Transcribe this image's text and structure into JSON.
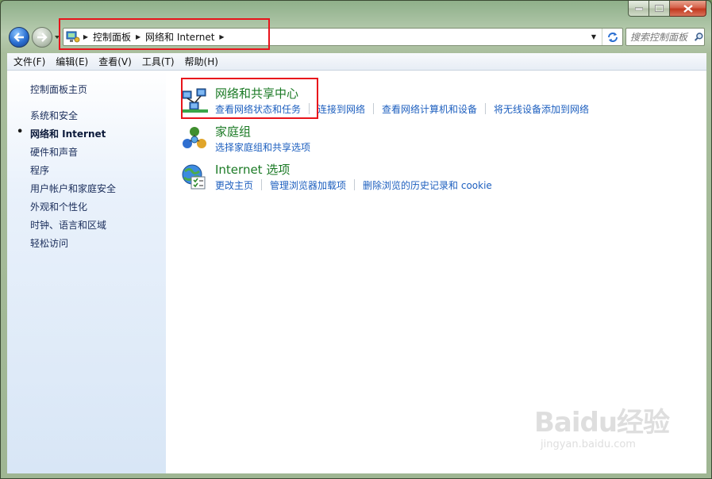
{
  "window": {
    "caption": {
      "minimize": "minimize",
      "maximize": "maximize",
      "close": "close"
    }
  },
  "address_bar": {
    "crumbs": [
      "控制面板",
      "网络和 Internet"
    ]
  },
  "search": {
    "placeholder": "搜索控制面板"
  },
  "menu": [
    "文件(F)",
    "编辑(E)",
    "查看(V)",
    "工具(T)",
    "帮助(H)"
  ],
  "sidebar": {
    "home": "控制面板主页",
    "items": [
      "系统和安全",
      "网络和 Internet",
      "硬件和声音",
      "程序",
      "用户帐户和家庭安全",
      "外观和个性化",
      "时钟、语言和区域",
      "轻松访问"
    ],
    "active_index": 1
  },
  "categories": [
    {
      "title": "网络和共享中心",
      "icon": "network-sharing-center-icon",
      "links": [
        "查看网络状态和任务",
        "连接到网络",
        "查看网络计算机和设备",
        "将无线设备添加到网络"
      ]
    },
    {
      "title": "家庭组",
      "icon": "homegroup-icon",
      "links": [
        "选择家庭组和共享选项"
      ]
    },
    {
      "title": "Internet 选项",
      "icon": "internet-options-icon",
      "links": [
        "更改主页",
        "管理浏览器加载项",
        "删除浏览的历史记录和 cookie"
      ]
    }
  ],
  "watermark": {
    "brand": "Baidu经验",
    "site": "jingyan.baidu.com"
  },
  "colors": {
    "link": "#1d5fbf",
    "category_title": "#1b7a25",
    "highlight": "#e8141b",
    "sidebar_text": "#1a2d5a"
  }
}
